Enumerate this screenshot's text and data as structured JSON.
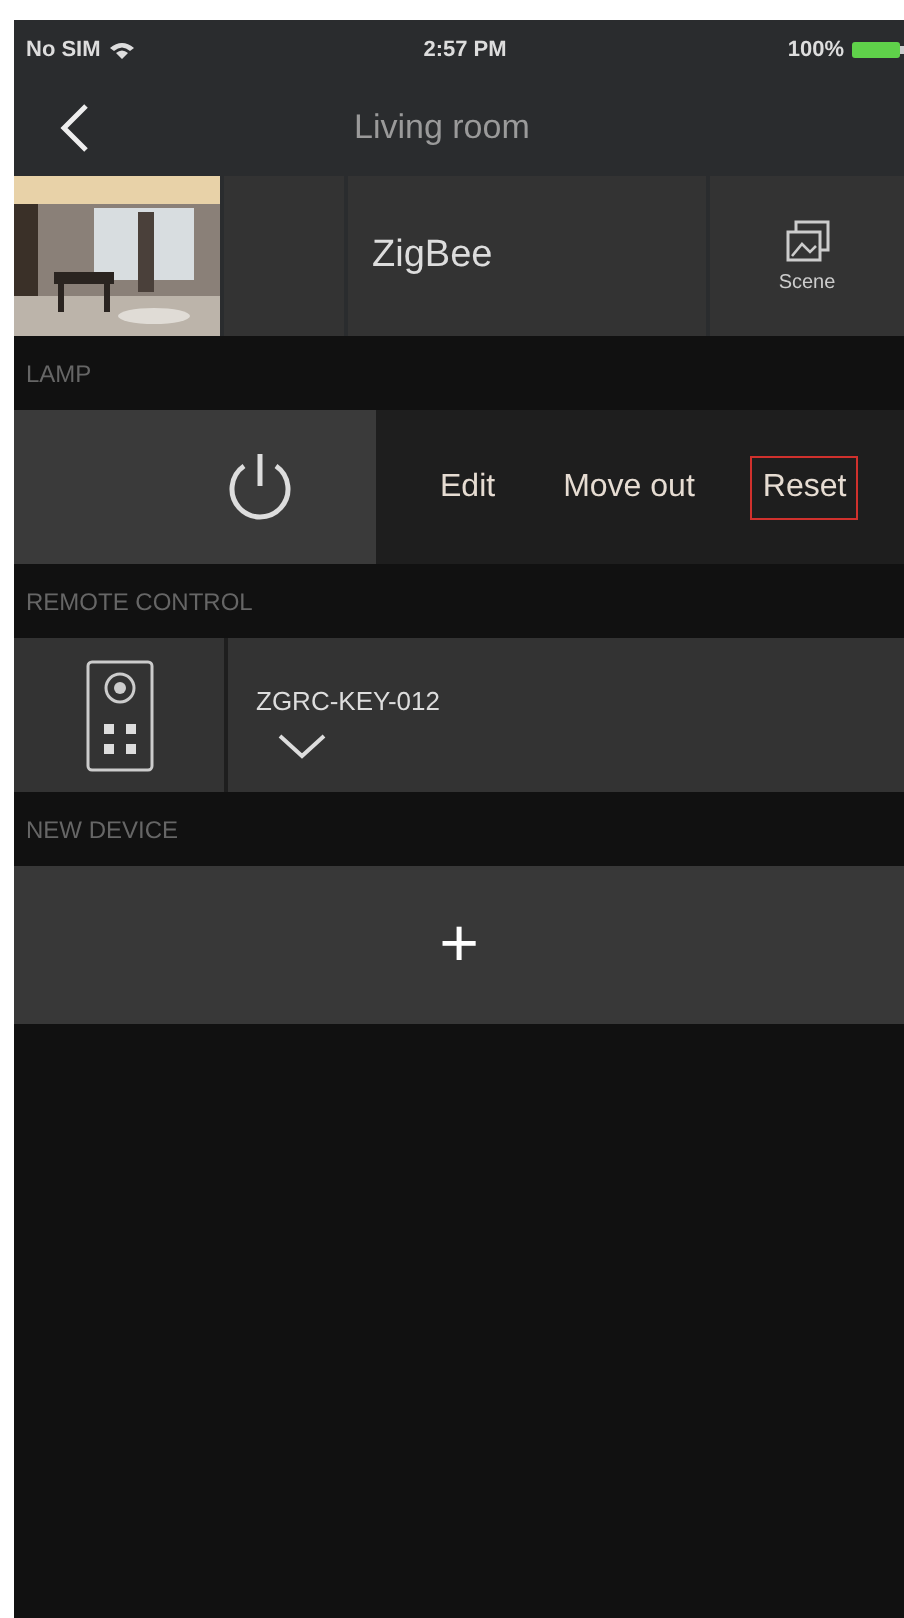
{
  "status_bar": {
    "carrier": "No SIM",
    "time": "2:57 PM",
    "battery": "100%"
  },
  "nav": {
    "title": "Living room"
  },
  "header": {
    "protocol": "ZigBee",
    "scene_label": "Scene"
  },
  "sections": [
    {
      "title": "LAMP",
      "kind": "lamp",
      "actions": [
        {
          "label": "Edit",
          "highlighted": false
        },
        {
          "label": "Move out",
          "highlighted": false
        },
        {
          "label": "Reset",
          "highlighted": true
        }
      ]
    },
    {
      "title": "REMOTE CONTROL",
      "kind": "remote",
      "name": "ZGRC-KEY-012"
    },
    {
      "title": "NEW DEVICE",
      "kind": "add",
      "symbol": "+"
    }
  ]
}
